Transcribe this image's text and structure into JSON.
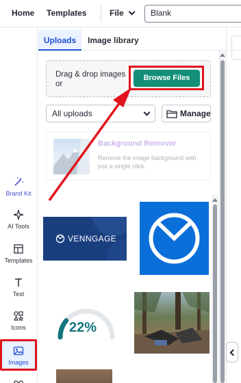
{
  "topbar": {
    "home": "Home",
    "templates": "Templates",
    "file": "File",
    "document_name": "Blank"
  },
  "rail": {
    "brand_kit": "Brand Kit",
    "ai_tools": "AI Tools",
    "templates": "Templates",
    "text": "Text",
    "icons": "Icons",
    "images": "Images"
  },
  "panel": {
    "tabs": [
      "Uploads",
      "Image library"
    ],
    "dropzone_text": "Drag & drop images or",
    "browse_button": "Browse Files",
    "filter_select": "All uploads",
    "manage_button": "Manage",
    "bg_remover": {
      "title": "Background Remover",
      "description": "Remove the image background with just a single click."
    },
    "uploads": {
      "venngage_logo_text": "VENNGAGE",
      "gauge_percent": "22%",
      "gauge_value": 0.22
    }
  },
  "colors": {
    "accent": "#1e4fd0",
    "browse": "#138f78",
    "highlight": "#e0141c",
    "brand_kit": "#4a4ec9"
  }
}
